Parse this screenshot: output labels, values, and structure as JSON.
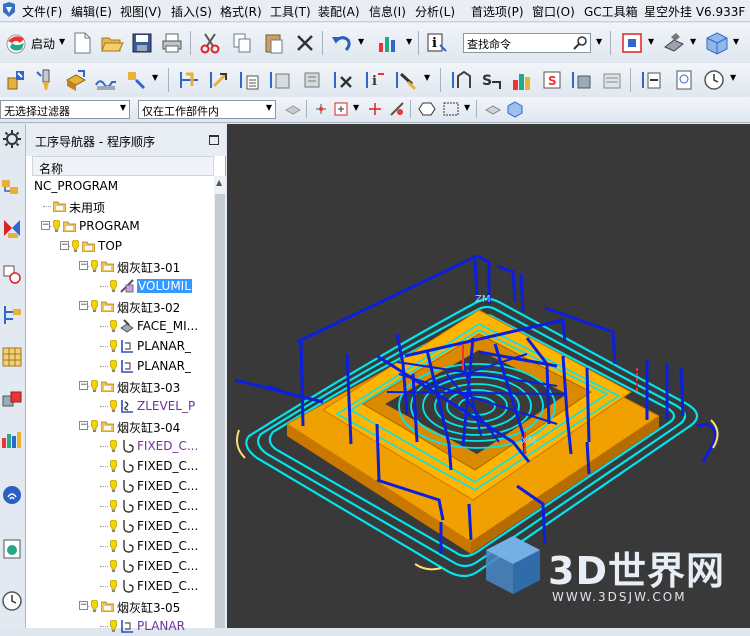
{
  "menubar": {
    "items": [
      "文件(F)",
      "编辑(E)",
      "视图(V)",
      "插入(S)",
      "格式(R)",
      "工具(T)",
      "装配(A)",
      "信息(I)",
      "分析(L)",
      "首选项(P)",
      "窗口(O)",
      "GC工具箱",
      "星空外挂 V6.933F"
    ]
  },
  "toolbar": {
    "start_label": "启动",
    "search_placeholder": "查找命令"
  },
  "filter": {
    "selection_filter": "无选择过滤器",
    "scope": "仅在工作部件内"
  },
  "navigator": {
    "title": "工序导航器 - 程序顺序",
    "column_header": "名称",
    "rows": [
      {
        "label": "NC_PROGRAM"
      },
      {
        "label": "未用项"
      },
      {
        "label": "PROGRAM"
      },
      {
        "label": "TOP"
      },
      {
        "label": "烟灰缸3-01"
      },
      {
        "label": "VOLUMIL"
      },
      {
        "label": "烟灰缸3-02"
      },
      {
        "label": "FACE_MI..."
      },
      {
        "label": "PLANAR_"
      },
      {
        "label": "PLANAR_"
      },
      {
        "label": "烟灰缸3-03"
      },
      {
        "label": "ZLEVEL_P"
      },
      {
        "label": "烟灰缸3-04"
      },
      {
        "label": "FIXED_C..."
      },
      {
        "label": "FIXED_C..."
      },
      {
        "label": "FIXED_C..."
      },
      {
        "label": "FIXED_C..."
      },
      {
        "label": "FIXED_C..."
      },
      {
        "label": "FIXED_C..."
      },
      {
        "label": "FIXED_C..."
      },
      {
        "label": "FIXED_C..."
      },
      {
        "label": "烟灰缸3-05"
      },
      {
        "label": "PLANAR"
      }
    ]
  },
  "viewport": {
    "axis_label": "ZM",
    "axis_label_2": "XM",
    "part_color": "#f5a800",
    "toolpath_color": "#00e5ee",
    "rapid_color": "#0a1fe0"
  },
  "watermark": {
    "brand": "3D世界网",
    "url": "WWW.3DSJW.COM"
  }
}
